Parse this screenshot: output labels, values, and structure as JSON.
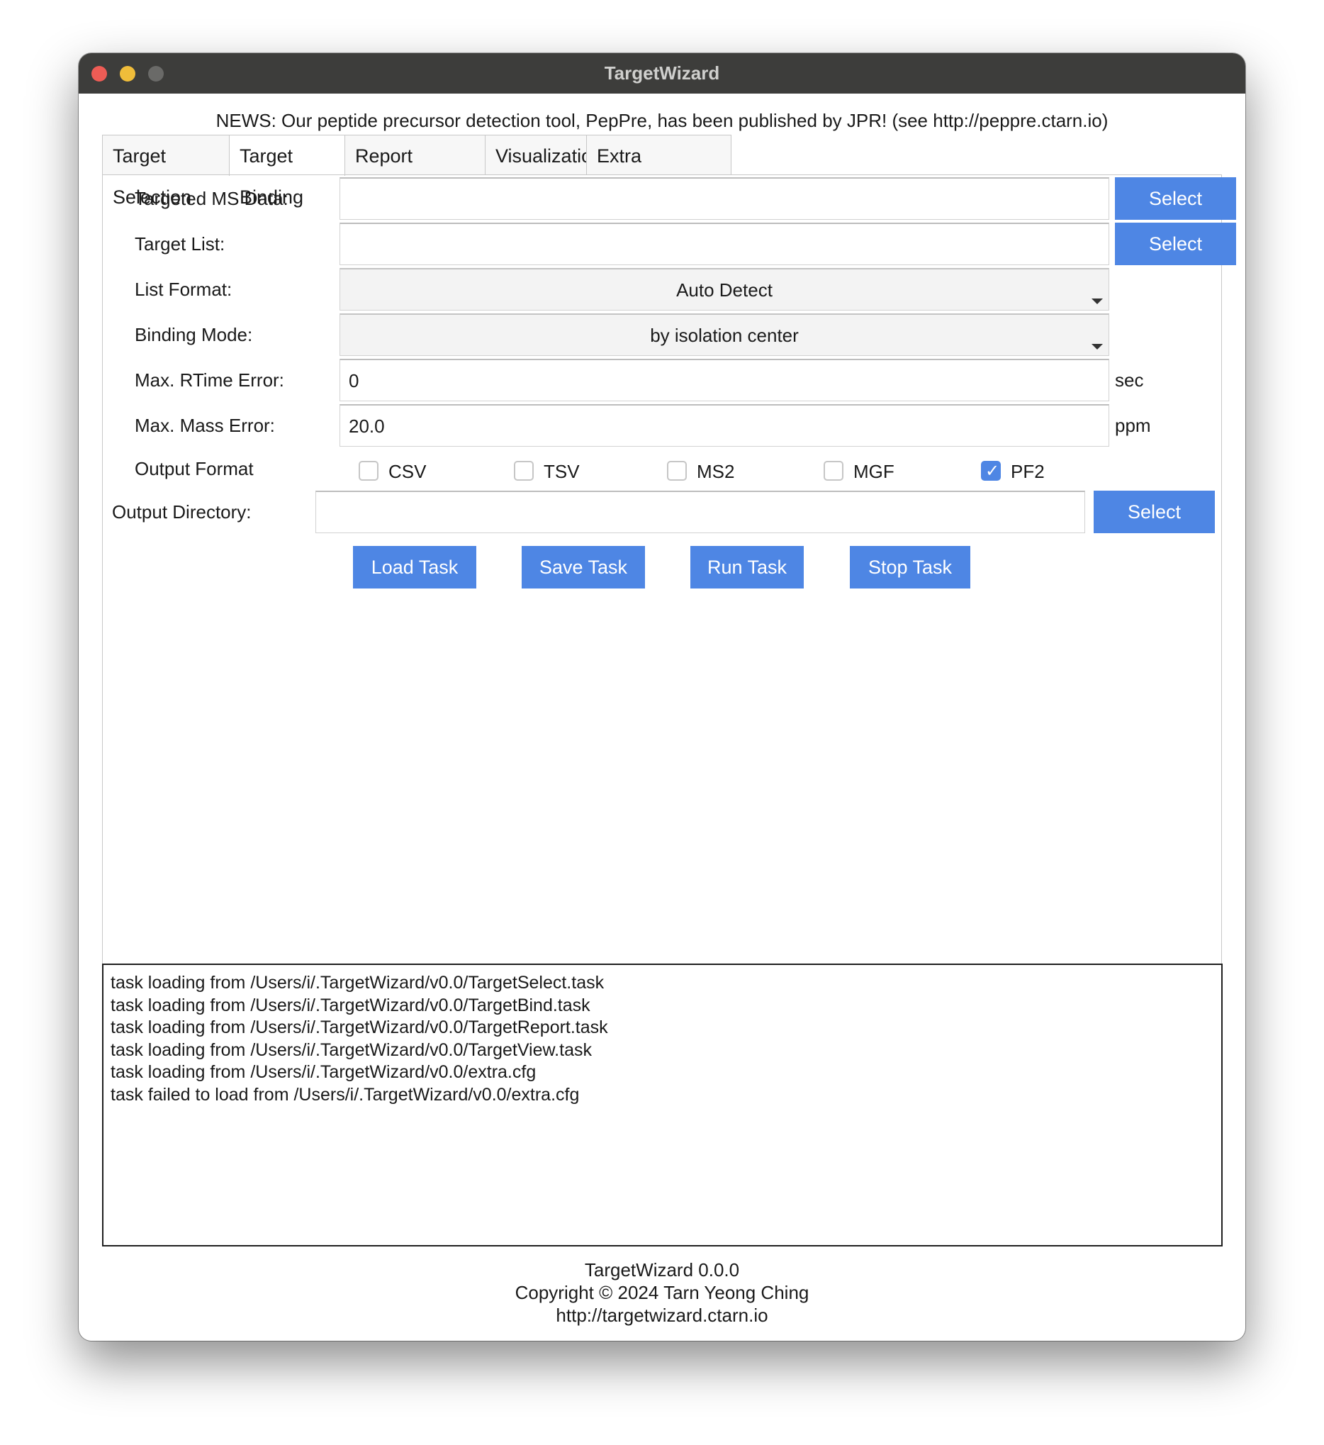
{
  "window": {
    "title": "TargetWizard"
  },
  "news": "NEWS: Our peptide precursor detection tool, PepPre, has been published by JPR! (see http://peppre.ctarn.io)",
  "tabs": [
    {
      "label": "Target Selection",
      "active": false
    },
    {
      "label": "Target Binding",
      "active": true
    },
    {
      "label": "Report Generation",
      "active": false
    },
    {
      "label": "Visualization",
      "active": false
    },
    {
      "label": "Extra Configuration",
      "active": false
    }
  ],
  "form": {
    "targeted_ms_data": {
      "label": "Targeted MS Data:",
      "value": "",
      "button": "Select"
    },
    "target_list": {
      "label": "Target List:",
      "value": "",
      "button": "Select"
    },
    "list_format": {
      "label": "List Format:",
      "value": "Auto Detect"
    },
    "binding_mode": {
      "label": "Binding Mode:",
      "value": "by isolation center"
    },
    "max_rtime_error": {
      "label": "Max. RTime Error:",
      "value": "0",
      "unit": "sec"
    },
    "max_mass_error": {
      "label": "Max. Mass Error:",
      "value": "20.0",
      "unit": "ppm"
    },
    "output_format": {
      "label": "Output Format",
      "options": [
        {
          "label": "CSV",
          "checked": false
        },
        {
          "label": "TSV",
          "checked": false
        },
        {
          "label": "MS2",
          "checked": false
        },
        {
          "label": "MGF",
          "checked": false
        },
        {
          "label": "PF2",
          "checked": true
        }
      ]
    },
    "output_directory": {
      "label": "Output Directory:",
      "value": "",
      "button": "Select"
    }
  },
  "actions": {
    "load": "Load Task",
    "save": "Save Task",
    "run": "Run Task",
    "stop": "Stop Task"
  },
  "log": [
    "task loading from /Users/i/.TargetWizard/v0.0/TargetSelect.task",
    "task loading from /Users/i/.TargetWizard/v0.0/TargetBind.task",
    "task loading from /Users/i/.TargetWizard/v0.0/TargetReport.task",
    "task loading from /Users/i/.TargetWizard/v0.0/TargetView.task",
    "task loading from /Users/i/.TargetWizard/v0.0/extra.cfg",
    "task failed to load from /Users/i/.TargetWizard/v0.0/extra.cfg"
  ],
  "footer": {
    "version": "TargetWizard 0.0.0",
    "copyright": "Copyright © 2024 Tarn Yeong Ching",
    "url": "http://targetwizard.ctarn.io"
  },
  "colors": {
    "accent": "#4e86e4",
    "titlebar": "#3d3d3b"
  }
}
